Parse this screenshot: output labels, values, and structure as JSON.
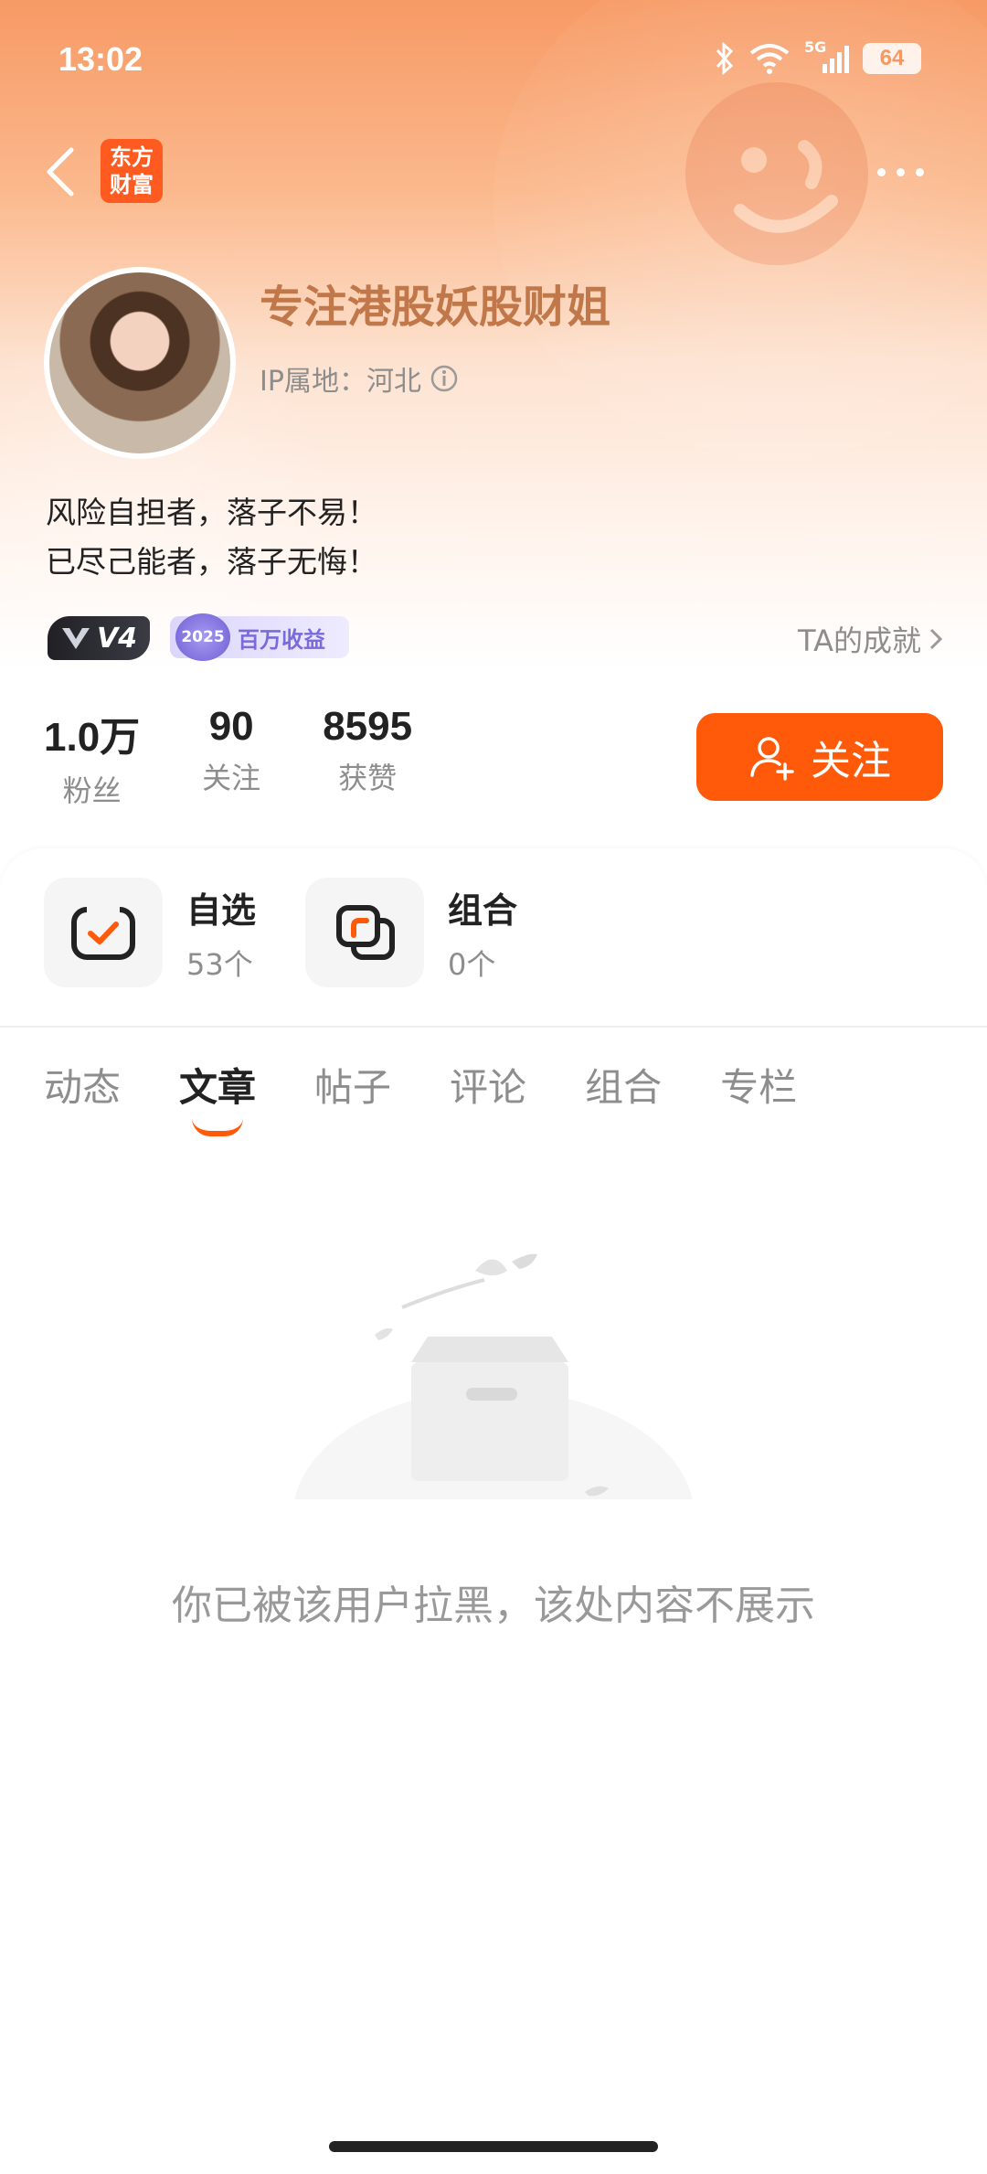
{
  "status_bar": {
    "time": "13:02",
    "network": "5G",
    "battery": "64"
  },
  "nav": {
    "logo_line1": "东方",
    "logo_line2": "财富"
  },
  "profile": {
    "username": "专注港股妖股财姐",
    "ip_location": "IP属地：河北",
    "bio_line1": "风险自担者，落子不易！",
    "bio_line2": "已尽己能者，落子无悔！",
    "level_badge": "V4",
    "medal_year": "2025",
    "medal_label": "百万收益",
    "achievements_link": "TA的成就"
  },
  "stats": [
    {
      "value": "1.0万",
      "label": "粉丝"
    },
    {
      "value": "90",
      "label": "关注"
    },
    {
      "value": "8595",
      "label": "获赞"
    }
  ],
  "follow_button": "关注",
  "quick_entries": [
    {
      "title": "自选",
      "count": "53个"
    },
    {
      "title": "组合",
      "count": "0个"
    }
  ],
  "tabs": [
    {
      "label": "动态",
      "active": false
    },
    {
      "label": "文章",
      "active": true
    },
    {
      "label": "帖子",
      "active": false
    },
    {
      "label": "评论",
      "active": false
    },
    {
      "label": "组合",
      "active": false
    },
    {
      "label": "专栏",
      "active": false
    }
  ],
  "empty_state": {
    "message": "你已被该用户拉黑，该处内容不展示"
  },
  "colors": {
    "accent": "#ff5a0a",
    "username": "#c0784a",
    "muted": "#8d8d8d"
  }
}
